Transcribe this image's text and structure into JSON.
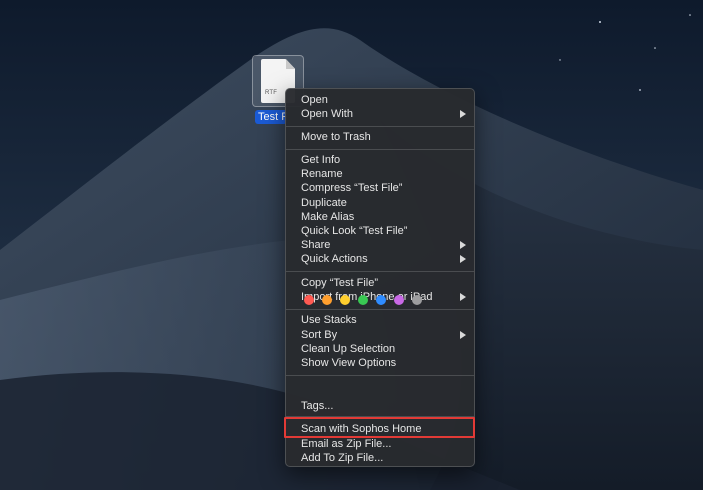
{
  "desktop": {
    "file_name": "Test File",
    "file_label_visible": "Test F",
    "file_type_label": "RTF"
  },
  "menu": {
    "group1": [
      {
        "label": "Open"
      },
      {
        "label": "Open With",
        "submenu": true
      }
    ],
    "group2": [
      {
        "label": "Move to Trash"
      }
    ],
    "group3": [
      {
        "label": "Get Info"
      },
      {
        "label": "Rename"
      },
      {
        "label": "Compress “Test File”"
      },
      {
        "label": "Duplicate"
      },
      {
        "label": "Make Alias"
      },
      {
        "label": "Quick Look “Test File”"
      },
      {
        "label": "Share",
        "submenu": true
      },
      {
        "label": "Quick Actions",
        "submenu": true
      }
    ],
    "group4": [
      {
        "label": "Copy “Test File”"
      },
      {
        "label": "Import from iPhone or iPad",
        "submenu": true
      }
    ],
    "group5": [
      {
        "label": "Use Stacks"
      },
      {
        "label": "Sort By",
        "submenu": true
      },
      {
        "label": "Clean Up Selection"
      },
      {
        "label": "Show View Options"
      }
    ],
    "tag_colors": [
      "#ff5a52",
      "#ff9f2e",
      "#ffcf2e",
      "#39c853",
      "#2f8cff",
      "#c969e6",
      "#9d9d9f"
    ],
    "tags_label": "Tags...",
    "group6": [
      {
        "label": "Scan with Sophos Home"
      },
      {
        "label": "Email as Zip File..."
      },
      {
        "label": "Add To Zip File..."
      }
    ]
  },
  "colors": {
    "highlight_border": "#e23a36",
    "selection_blue": "#1b5bd6"
  }
}
